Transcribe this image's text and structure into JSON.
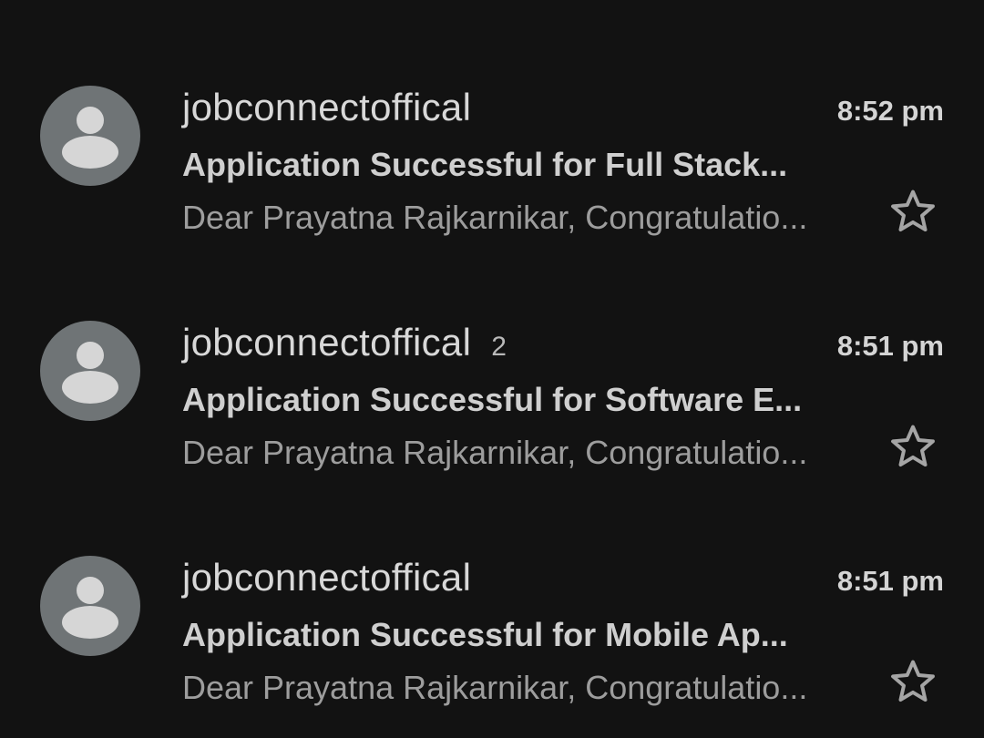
{
  "colors": {
    "background": "#121212",
    "avatar": "#6f7476",
    "avatar_glyph": "#d6d6d6",
    "star_outline": "#a5a5a5"
  },
  "emails": [
    {
      "sender": "jobconnectoffical",
      "thread_count": "",
      "time": "8:52 pm",
      "subject": "Application Successful for Full Stack...",
      "snippet": "Dear Prayatna Rajkarnikar, Congratulatio...",
      "avatar_icon": "person-icon",
      "starred": false
    },
    {
      "sender": "jobconnectoffical",
      "thread_count": "2",
      "time": "8:51 pm",
      "subject": "Application Successful for Software E...",
      "snippet": "Dear Prayatna Rajkarnikar, Congratulatio...",
      "avatar_icon": "person-icon",
      "starred": false
    },
    {
      "sender": "jobconnectoffical",
      "thread_count": "",
      "time": "8:51 pm",
      "subject": "Application Successful for Mobile Ap...",
      "snippet": "Dear Prayatna Rajkarnikar, Congratulatio...",
      "avatar_icon": "person-icon",
      "starred": false
    }
  ]
}
